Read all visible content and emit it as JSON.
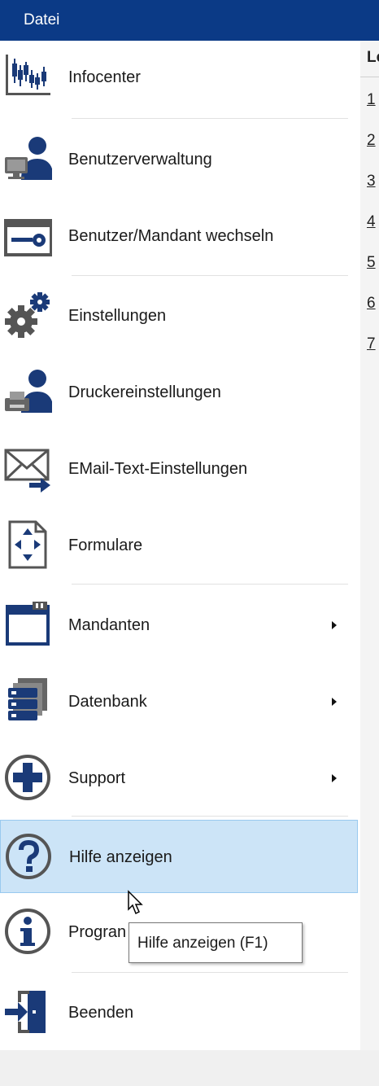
{
  "topbar": {
    "title": "Datei"
  },
  "menu": {
    "items": [
      {
        "label": "Infocenter",
        "icon": "candlestick-chart-icon"
      },
      {
        "label": "Benutzerverwaltung",
        "icon": "user-computer-icon"
      },
      {
        "label": "Benutzer/Mandant wechseln",
        "icon": "key-card-icon"
      },
      {
        "label": "Einstellungen",
        "icon": "gears-icon"
      },
      {
        "label": "Druckereinstellungen",
        "icon": "printer-user-icon"
      },
      {
        "label": "EMail-Text-Einstellungen",
        "icon": "envelope-arrow-icon"
      },
      {
        "label": "Formulare",
        "icon": "form-page-icon"
      },
      {
        "label": "Mandanten",
        "icon": "window-folder-icon",
        "submenu": true
      },
      {
        "label": "Datenbank",
        "icon": "database-icon",
        "submenu": true
      },
      {
        "label": "Support",
        "icon": "plus-circle-icon",
        "submenu": true
      },
      {
        "label": "Hilfe anzeigen",
        "icon": "question-circle-icon",
        "hovered": true
      },
      {
        "label": "Progran",
        "icon": "info-circle-icon"
      },
      {
        "label": "Beenden",
        "icon": "exit-door-icon"
      }
    ]
  },
  "tooltip": {
    "text": "Hilfe anzeigen (F1)"
  },
  "right_pane": {
    "header": "Le",
    "numbers": [
      "1",
      "2",
      "3",
      "4",
      "5",
      "6",
      "7"
    ]
  },
  "colors": {
    "topbar": "#0b3a86",
    "icon_blue": "#1a3a78",
    "hover_bg": "#cce4f7",
    "hover_border": "#99c9ef"
  }
}
